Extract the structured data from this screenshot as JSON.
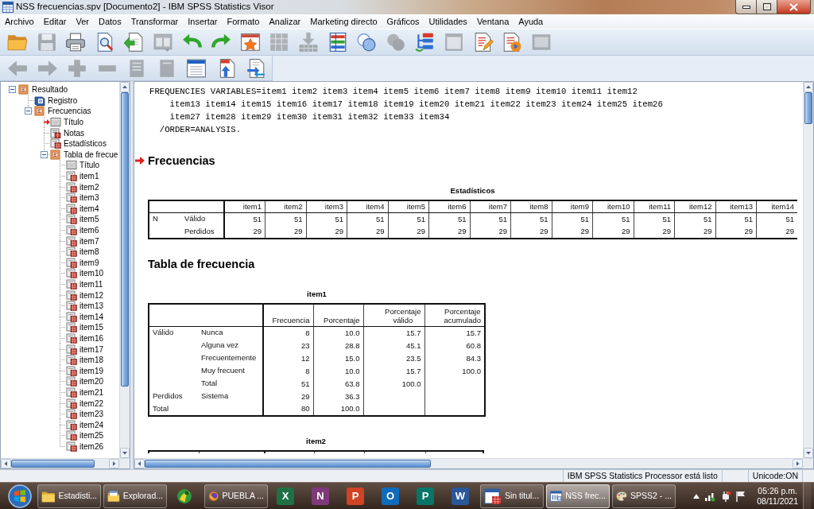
{
  "window": {
    "title": "NSS frecuencias.spv [Documento2] - IBM SPSS Statistics Visor"
  },
  "menu": [
    "Archivo",
    "Editar",
    "Ver",
    "Datos",
    "Transformar",
    "Insertar",
    "Formato",
    "Analizar",
    "Marketing directo",
    "Gráficos",
    "Utilidades",
    "Ventana",
    "Ayuda"
  ],
  "toolbars": [
    {
      "buttons": [
        {
          "kind": "open",
          "disabled": false
        },
        {
          "kind": "save",
          "disabled": true
        },
        {
          "kind": "print",
          "disabled": false
        },
        {
          "kind": "preview",
          "disabled": false
        },
        {
          "kind": "export",
          "disabled": false
        },
        {
          "kind": "recall",
          "disabled": true
        },
        {
          "kind": "undo",
          "disabled": false
        },
        {
          "kind": "redo",
          "disabled": false
        },
        {
          "kind": "data",
          "disabled": false
        },
        {
          "kind": "goto",
          "disabled": true
        },
        {
          "kind": "insert",
          "disabled": true
        },
        {
          "kind": "variables",
          "disabled": false
        },
        {
          "kind": "sets",
          "disabled": false
        },
        {
          "kind": "allsets",
          "disabled": true
        },
        {
          "kind": "navigate",
          "disabled": false
        },
        {
          "kind": "designate",
          "disabled": true
        },
        {
          "kind": "edit",
          "disabled": false
        },
        {
          "kind": "run",
          "disabled": false
        },
        {
          "kind": "pane",
          "disabled": true
        }
      ]
    },
    {
      "buttons": [
        {
          "kind": "promote",
          "disabled": true
        },
        {
          "kind": "demote",
          "disabled": true
        },
        {
          "kind": "expand",
          "disabled": true
        },
        {
          "kind": "collapse",
          "disabled": true
        },
        {
          "kind": "show",
          "disabled": true
        },
        {
          "kind": "hide",
          "disabled": true
        },
        {
          "kind": "heading",
          "disabled": false
        },
        {
          "kind": "title",
          "disabled": false
        },
        {
          "kind": "text",
          "disabled": false
        }
      ]
    }
  ],
  "tree": [
    {
      "label": "Resultado",
      "kind": "output",
      "expanded": true,
      "selected": false,
      "children": [
        {
          "label": "Registro",
          "kind": "log",
          "selected": false
        },
        {
          "label": "Frecuencias",
          "kind": "output",
          "expanded": true,
          "selected": false,
          "children": [
            {
              "label": "Título",
              "kind": "title",
              "selected": true
            },
            {
              "label": "Notas",
              "kind": "notes",
              "selected": false
            },
            {
              "label": "Estadísticos",
              "kind": "table",
              "selected": false
            },
            {
              "label": "Tabla de frecue",
              "kind": "output",
              "expanded": true,
              "selected": false,
              "children": [
                {
                  "label": "Título",
                  "kind": "title",
                  "selected": false
                },
                {
                  "label": "item1",
                  "kind": "table",
                  "selected": false
                },
                {
                  "label": "item2",
                  "kind": "table",
                  "selected": false
                },
                {
                  "label": "item3",
                  "kind": "table",
                  "selected": false
                },
                {
                  "label": "item4",
                  "kind": "table",
                  "selected": false
                },
                {
                  "label": "item5",
                  "kind": "table",
                  "selected": false
                },
                {
                  "label": "item6",
                  "kind": "table",
                  "selected": false
                },
                {
                  "label": "item7",
                  "kind": "table",
                  "selected": false
                },
                {
                  "label": "item8",
                  "kind": "table",
                  "selected": false
                },
                {
                  "label": "item9",
                  "kind": "table",
                  "selected": false
                },
                {
                  "label": "item10",
                  "kind": "table",
                  "selected": false
                },
                {
                  "label": "item11",
                  "kind": "table",
                  "selected": false
                },
                {
                  "label": "item12",
                  "kind": "table",
                  "selected": false
                },
                {
                  "label": "item13",
                  "kind": "table",
                  "selected": false
                },
                {
                  "label": "item14",
                  "kind": "table",
                  "selected": false
                },
                {
                  "label": "item15",
                  "kind": "table",
                  "selected": false
                },
                {
                  "label": "item16",
                  "kind": "table",
                  "selected": false
                },
                {
                  "label": "item17",
                  "kind": "table",
                  "selected": false
                },
                {
                  "label": "item18",
                  "kind": "table",
                  "selected": false
                },
                {
                  "label": "item19",
                  "kind": "table",
                  "selected": false
                },
                {
                  "label": "item20",
                  "kind": "table",
                  "selected": false
                },
                {
                  "label": "item21",
                  "kind": "table",
                  "selected": false
                },
                {
                  "label": "item22",
                  "kind": "table",
                  "selected": false
                },
                {
                  "label": "item23",
                  "kind": "table",
                  "selected": false
                },
                {
                  "label": "item24",
                  "kind": "table",
                  "selected": false
                },
                {
                  "label": "item25",
                  "kind": "table",
                  "selected": false
                },
                {
                  "label": "item26",
                  "kind": "table",
                  "selected": false
                }
              ]
            }
          ]
        }
      ]
    }
  ],
  "output": [
    {
      "kind": "syntax",
      "lines": [
        "FREQUENCIES VARIABLES=item1 item2 item3 item4 item5 item6 item7 item8 item9 item10 item11 item12",
        "    item13 item14 item15 item16 item17 item18 item19 item20 item21 item22 item23 item24 item25 item26",
        "    item27 item28 item29 item30 item31 item32 item33 item34",
        "  /ORDER=ANALYSIS."
      ]
    },
    {
      "kind": "heading",
      "text": "Frecuencias",
      "selected": true
    },
    {
      "kind": "stats_table",
      "title": "Estadísticos",
      "columns": [
        "item1",
        "item2",
        "item3",
        "item4",
        "item5",
        "item6",
        "item7",
        "item8",
        "item9",
        "item10",
        "item11",
        "item12",
        "item13",
        "item14"
      ],
      "rows": [
        {
          "group": "N",
          "label": "Válido",
          "values": [
            "51",
            "51",
            "51",
            "51",
            "51",
            "51",
            "51",
            "51",
            "51",
            "51",
            "51",
            "51",
            "51",
            "51"
          ]
        },
        {
          "label": "Perdidos",
          "values": [
            "29",
            "29",
            "29",
            "29",
            "29",
            "29",
            "29",
            "29",
            "29",
            "29",
            "29",
            "29",
            "29",
            "29"
          ]
        }
      ]
    },
    {
      "kind": "heading",
      "text": "Tabla de frecuencia",
      "selected": false
    },
    {
      "kind": "freq_table",
      "title": "item1",
      "columns": [
        "Frecuencia",
        "Porcentaje",
        "Porcentaje válido",
        "Porcentaje acumulado"
      ],
      "rows": [
        {
          "group": "Válido",
          "label": "Nunca",
          "values": [
            "8",
            "10.0",
            "15.7",
            "15.7"
          ]
        },
        {
          "label": "Alguna vez",
          "values": [
            "23",
            "28.8",
            "45.1",
            "60.8"
          ]
        },
        {
          "label": "Frecuentemente",
          "values": [
            "12",
            "15.0",
            "23.5",
            "84.3"
          ]
        },
        {
          "label": "Muy frecuent",
          "values": [
            "8",
            "10.0",
            "15.7",
            "100.0"
          ]
        },
        {
          "label": "Total",
          "values": [
            "51",
            "63.8",
            "100.0"
          ]
        },
        {
          "group": "Perdidos",
          "label": "Sistema",
          "values": [
            "29",
            "36.3"
          ]
        },
        {
          "group": "Total",
          "values": [
            "80",
            "100.0"
          ]
        }
      ]
    },
    {
      "kind": "table_stub",
      "title": "item2"
    }
  ],
  "status_bar": {
    "message": "IBM SPSS Statistics Processor está listo",
    "encoding": "Unicode:ON"
  },
  "taskbar": {
    "items": [
      {
        "kind": "folder",
        "label": "Estadisti...",
        "selected": false
      },
      {
        "kind": "explorer",
        "label": "Explorad...",
        "selected": false
      },
      {
        "kind": "pinned",
        "selected": false
      },
      {
        "kind": "browser",
        "label": "PUEBLA ...",
        "selected": false
      },
      {
        "kind": "office",
        "glyph": "X",
        "color": "#1e7145",
        "selected": false
      },
      {
        "kind": "office",
        "glyph": "N",
        "color": "#80397b",
        "selected": false
      },
      {
        "kind": "office",
        "glyph": "P",
        "color": "#d04423",
        "selected": false
      },
      {
        "kind": "office",
        "glyph": "O",
        "color": "#0f6cbd",
        "selected": false
      },
      {
        "kind": "office",
        "glyph": "P",
        "color": "#077568",
        "selected": false
      },
      {
        "kind": "office",
        "glyph": "W",
        "color": "#2b579a",
        "selected": false
      },
      {
        "kind": "dataeditor",
        "label": "Sin titul...",
        "selected": false
      },
      {
        "kind": "viewer",
        "label": "NSS frec...",
        "selected": true
      },
      {
        "kind": "paint",
        "label": "SPSS2 - ...",
        "selected": false
      }
    ],
    "clock": {
      "time": "05:26 p.m.",
      "date": "08/11/2021"
    }
  }
}
